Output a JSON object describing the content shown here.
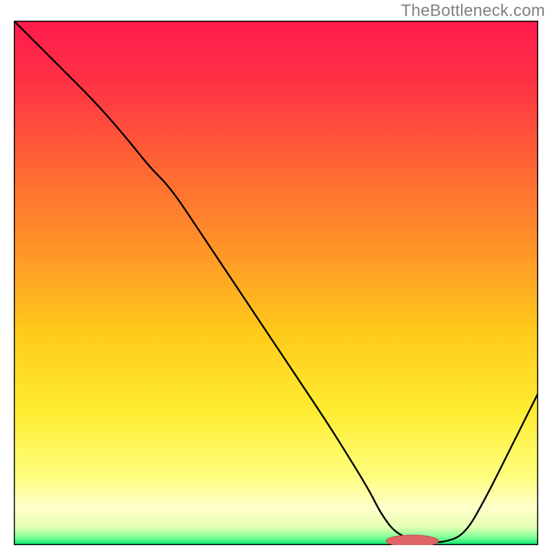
{
  "attribution": "TheBottleneck.com",
  "chart_data": {
    "type": "line",
    "title": "",
    "xlabel": "",
    "ylabel": "",
    "xlim": [
      0,
      100
    ],
    "ylim": [
      0,
      100
    ],
    "legend": [],
    "annotations": [],
    "background_gradient_stops": [
      {
        "offset": 0.0,
        "color": "#ff1a4d"
      },
      {
        "offset": 0.12,
        "color": "#ff3344"
      },
      {
        "offset": 0.28,
        "color": "#ff6633"
      },
      {
        "offset": 0.45,
        "color": "#ff9926"
      },
      {
        "offset": 0.6,
        "color": "#ffcc1a"
      },
      {
        "offset": 0.75,
        "color": "#ffee33"
      },
      {
        "offset": 0.87,
        "color": "#ffff80"
      },
      {
        "offset": 0.93,
        "color": "#ffffcc"
      },
      {
        "offset": 0.965,
        "color": "#e6ffb3"
      },
      {
        "offset": 0.985,
        "color": "#80ff99"
      },
      {
        "offset": 1.0,
        "color": "#00e66e"
      }
    ],
    "series": [
      {
        "name": "bottleneck-curve",
        "color": "#000000",
        "stroke_width": 2.5,
        "x": [
          0,
          8,
          16,
          22,
          26,
          30,
          36,
          42,
          48,
          54,
          60,
          65,
          68,
          70,
          73,
          78,
          82,
          86,
          90,
          94,
          98,
          100
        ],
        "y": [
          100,
          92,
          84,
          77,
          72,
          68,
          59,
          50,
          41,
          32,
          23,
          15,
          10,
          6,
          2,
          0.5,
          0.5,
          2,
          9,
          17,
          25,
          29
        ]
      }
    ],
    "marker": {
      "name": "optimal-range",
      "cx": 76,
      "cy": 0.8,
      "rx": 5,
      "ry": 1.1,
      "fill": "#e06666",
      "stroke": "#c74f4f"
    },
    "border": {
      "color": "#000000",
      "width": 3
    }
  }
}
